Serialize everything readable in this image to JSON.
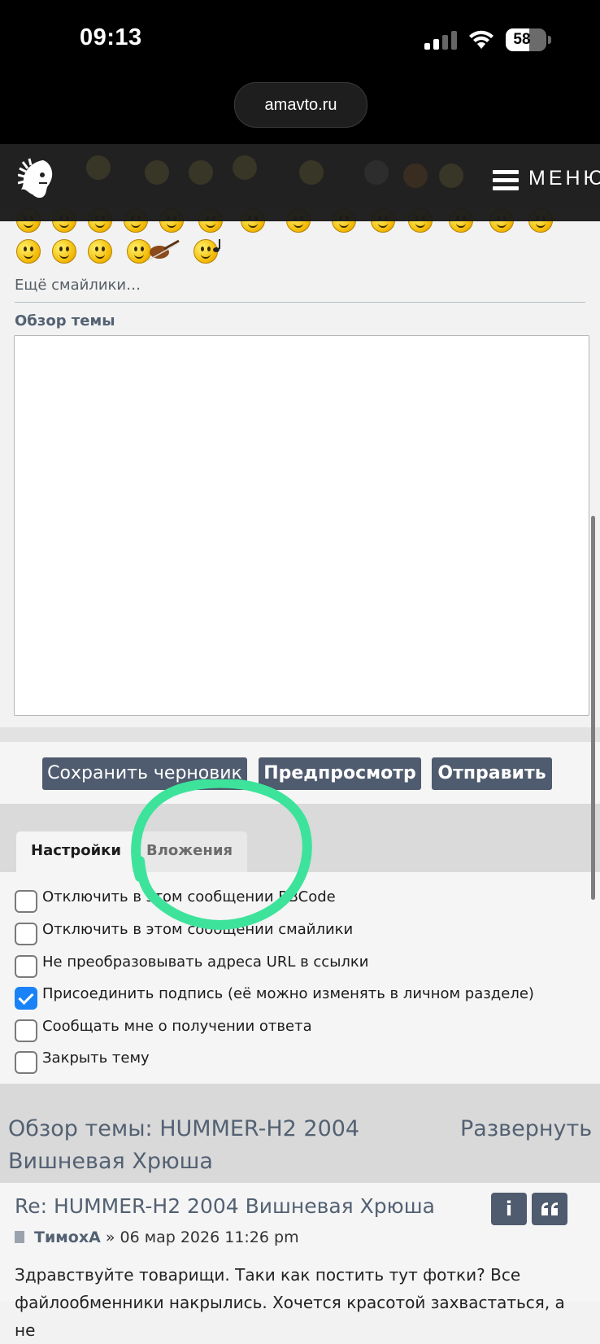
{
  "status_bar": {
    "time": "09:13",
    "battery": "58",
    "battery_level": 0.58
  },
  "browser": {
    "url": "amavto.ru"
  },
  "header": {
    "menu_label": "МЕНЮ"
  },
  "smileys": {
    "more_link": "Ещё смайлики…"
  },
  "editor": {
    "overview_label": "Обзор темы",
    "message_value": ""
  },
  "actions": {
    "save_draft": "Сохранить черновик",
    "preview": "Предпросмотр",
    "submit": "Отправить"
  },
  "tabs": [
    {
      "label": "Настройки",
      "active": true
    },
    {
      "label": "Вложения",
      "active": false
    }
  ],
  "options": [
    {
      "label": "Отключить в этом сообщении BBCode",
      "checked": false
    },
    {
      "label": "Отключить в этом сообщении смайлики",
      "checked": false
    },
    {
      "label": "Не преобразовывать адреса URL в ссылки",
      "checked": false
    },
    {
      "label": "Присоединить подпись (её можно изменять в личном разделе)",
      "checked": true
    },
    {
      "label": "Сообщать мне о получении ответа",
      "checked": false
    },
    {
      "label": "Закрыть тему",
      "checked": false
    }
  ],
  "review": {
    "title": "Обзор темы: HUMMER-H2 2004 Вишневая Хрюша",
    "expand": "Развернуть"
  },
  "post": {
    "subject": "Re: HUMMER-H2 2004 Вишневая Хрюша",
    "info_icon": "i",
    "quote_icon": "quote-icon",
    "author": "ТимохА",
    "separator": "»",
    "date": "06 мар 2026 11:26 pm",
    "body": "Здравствуйте товарищи. Таки как постить тут фотки? Все файлообменники накрылись. Хочется красотой захвастаться, а не"
  },
  "colors": {
    "accent": "#4f5b6e",
    "link": "#536173",
    "checkbox_on": "#1a82f7",
    "annotation": "#3ee39b"
  }
}
